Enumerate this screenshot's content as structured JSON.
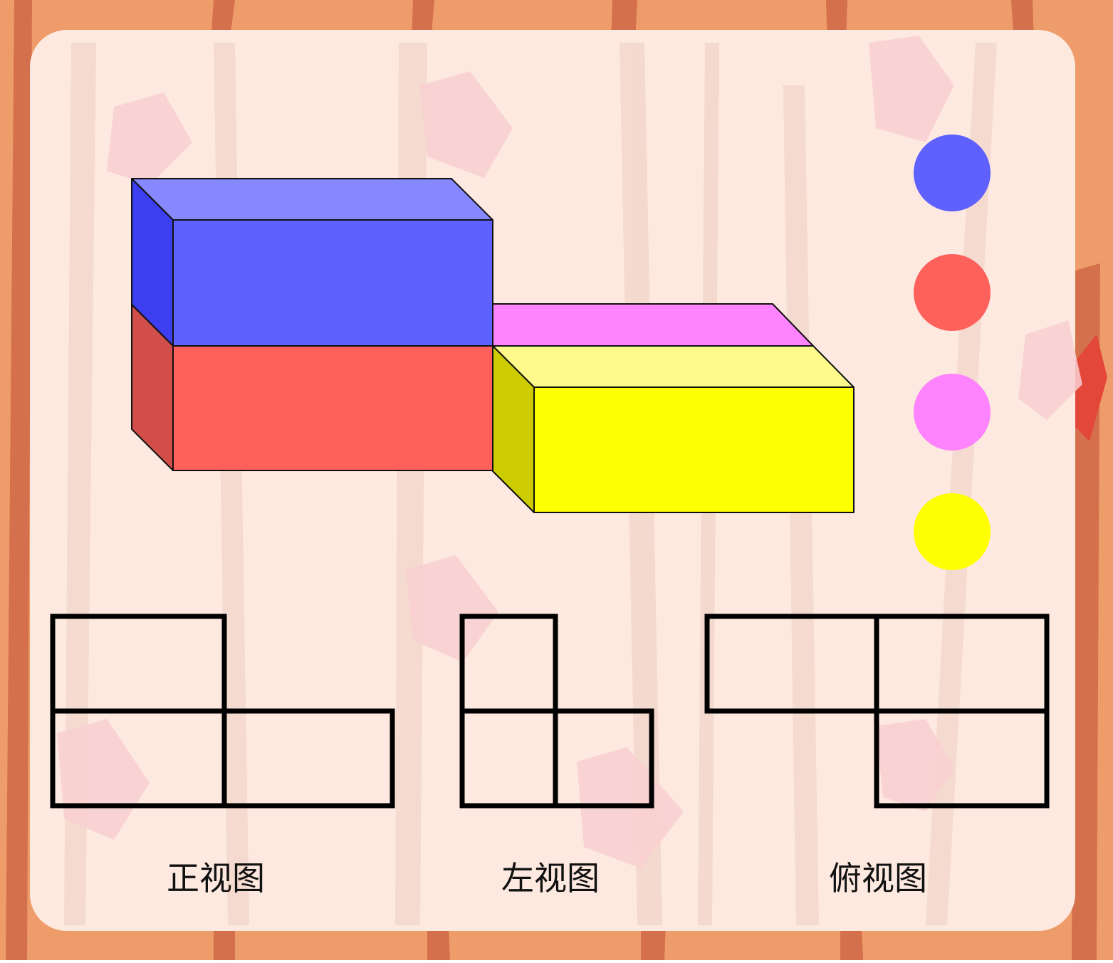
{
  "colors": {
    "frame": "#ee9d6a",
    "trunk": "#d4704c",
    "panel": "#fde9e0",
    "blue": "#5f61fe",
    "blue_side": "#3c3ef0",
    "blue_top": "#8689fe",
    "red": "#fe615b",
    "red_side": "#d24e4b",
    "pink": "#fe83fe",
    "yellow": "#feff02",
    "yellow_side": "#cccc00",
    "yellow_top": "#fefb8c"
  },
  "legend_dots": [
    {
      "name": "blue",
      "color": "#5f61fe"
    },
    {
      "name": "red",
      "color": "#fe615b"
    },
    {
      "name": "pink",
      "color": "#fe83fe"
    },
    {
      "name": "yellow",
      "color": "#feff02"
    }
  ],
  "views": {
    "front": "正视图",
    "left": "左视图",
    "top": "俯视图"
  }
}
